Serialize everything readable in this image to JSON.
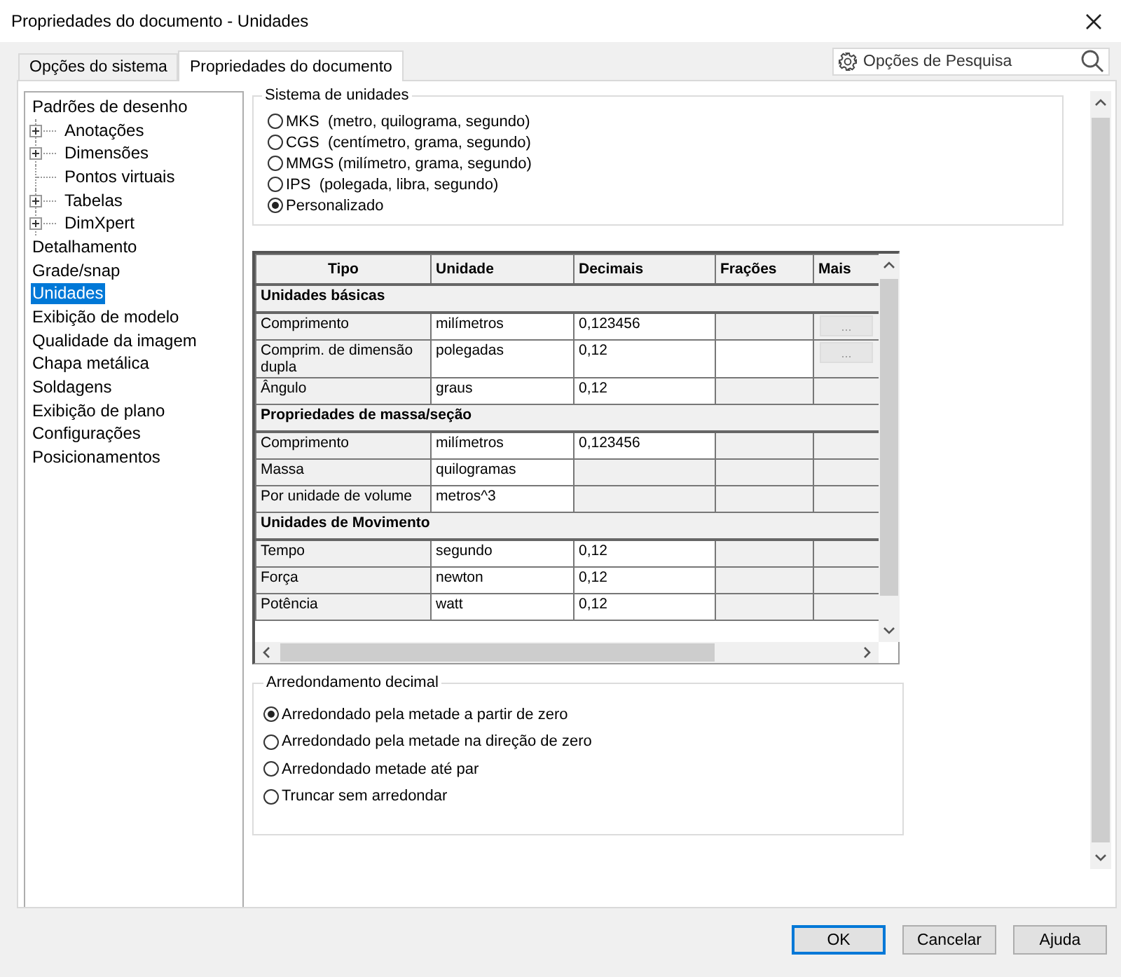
{
  "window": {
    "title": "Propriedades do documento - Unidades"
  },
  "tabs": [
    {
      "label": "Opções do sistema",
      "selected": false
    },
    {
      "label": "Propriedades do documento",
      "selected": true
    }
  ],
  "search": {
    "placeholder": "Opções de Pesquisa"
  },
  "sidebar": {
    "items": [
      {
        "label": "Padrões de desenho",
        "selected": false,
        "children": [
          {
            "label": "Anotações",
            "expandable": true,
            "selected": false
          },
          {
            "label": "Dimensões",
            "expandable": true,
            "selected": false
          },
          {
            "label": "Pontos virtuais",
            "expandable": false,
            "selected": false
          },
          {
            "label": "Tabelas",
            "expandable": true,
            "selected": false
          },
          {
            "label": "DimXpert",
            "expandable": true,
            "selected": false
          }
        ]
      },
      {
        "label": "Detalhamento",
        "selected": false
      },
      {
        "label": "Grade/snap",
        "selected": false
      },
      {
        "label": "Unidades",
        "selected": true
      },
      {
        "label": "Exibição de modelo",
        "selected": false
      },
      {
        "label": "Qualidade da imagem",
        "selected": false
      },
      {
        "label": "Chapa metálica",
        "selected": false
      },
      {
        "label": "Soldagens",
        "selected": false
      },
      {
        "label": "Exibição de plano",
        "selected": false
      },
      {
        "label": "Configurações",
        "selected": false
      },
      {
        "label": "Posicionamentos",
        "selected": false
      }
    ]
  },
  "unit_system": {
    "title": "Sistema de unidades",
    "options": [
      {
        "label": "MKS  (metro, quilograma, segundo)",
        "selected": false
      },
      {
        "label": "CGS  (centímetro, grama, segundo)",
        "selected": false
      },
      {
        "label": "MMGS (milímetro, grama, segundo)",
        "selected": false
      },
      {
        "label": "IPS  (polegada, libra, segundo)",
        "selected": false
      },
      {
        "label": "Personalizado",
        "selected": true
      }
    ]
  },
  "table": {
    "columns": [
      "Tipo",
      "Unidade",
      "Decimais",
      "Frações",
      "Mais"
    ],
    "groups": [
      {
        "title": "Unidades básicas",
        "rows": [
          {
            "type": "Comprimento",
            "unit": "milímetros",
            "decimals": "0,123456",
            "fractions_editable": false,
            "more": "..."
          },
          {
            "type": "Comprim. de dimensão dupla",
            "unit": "polegadas",
            "decimals": "0,12",
            "fractions_editable": true,
            "more": "..."
          },
          {
            "type": "Ângulo",
            "unit": "graus",
            "decimals": "0,12",
            "fractions_editable": false
          }
        ]
      },
      {
        "title": "Propriedades de massa/seção",
        "rows": [
          {
            "type": "Comprimento",
            "unit": "milímetros",
            "decimals": "0,123456",
            "fractions_editable": false
          },
          {
            "type": "Massa",
            "unit": "quilogramas",
            "fractions_editable": false
          },
          {
            "type": "Por unidade de volume",
            "unit": "metros^3",
            "fractions_editable": false
          }
        ]
      },
      {
        "title": "Unidades de Movimento",
        "rows": [
          {
            "type": "Tempo",
            "unit": "segundo",
            "decimals": "0,12",
            "fractions_editable": false
          },
          {
            "type": "Força",
            "unit": "newton",
            "decimals": "0,12",
            "fractions_editable": false
          },
          {
            "type": "Potência",
            "unit": "watt",
            "decimals": "0,12",
            "fractions_editable": false
          }
        ]
      }
    ]
  },
  "rounding": {
    "title": "Arredondamento decimal",
    "options": [
      {
        "label": "Arredondado pela metade a partir de zero",
        "selected": true
      },
      {
        "label": "Arredondado pela metade na direção de zero",
        "selected": false
      },
      {
        "label": "Arredondado metade até par",
        "selected": false
      },
      {
        "label": "Truncar sem arredondar",
        "selected": false
      }
    ]
  },
  "buttons": [
    {
      "label": "OK",
      "default": true
    },
    {
      "label": "Cancelar",
      "default": false
    },
    {
      "label": "Ajuda",
      "default": false
    }
  ]
}
